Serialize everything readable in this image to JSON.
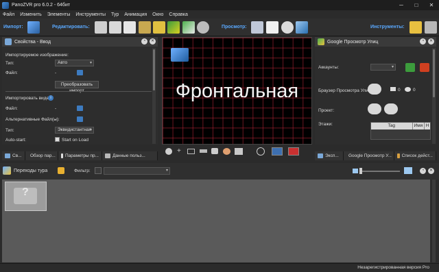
{
  "window": {
    "title": "PanoZVR pro 6.0.2 - 64бит",
    "minimize": "─",
    "maximize": "□",
    "close": "✕"
  },
  "menu": [
    "Файл",
    "Изменить",
    "Элементы",
    "Инструменты",
    "Тур",
    "Анимация",
    "Окно",
    "Справка"
  ],
  "toolbar": {
    "import_label": "Импорт:",
    "edit_label": "Редактировать:",
    "view_label": "Просмотр:",
    "tools_label": "Инструменты:"
  },
  "properties": {
    "title": "Свойства - Ввод",
    "imported_image_label": "Импортируемое изображение:",
    "type_label": "Тип:",
    "type_value": "Авто",
    "file_label": "Файл:",
    "file_value": "-",
    "transform_button": "Преобразовать импорт",
    "imported_video_label": "Импортировать видео:",
    "video_file_label": "Файл:",
    "video_file_value": "-",
    "alt_files_label": "Альтернативные Файл(ы):",
    "alt_files_value": "-",
    "video_type_label": "Тип:",
    "video_type_value": "Эквидистантная",
    "autostart_label": "Auto-start:",
    "start_on_load_label": "Start on Load"
  },
  "left_tabs": [
    "Св...",
    "Обзор пар...",
    "Параметры пр...",
    "Данные польз..."
  ],
  "viewer": {
    "face_label": "Фронтальная"
  },
  "streetview": {
    "title": "Google Просмотр Улиц",
    "accounts_label": "Аккаунты:",
    "browser_label": "Браузер Просмотра Улиц:",
    "count_views": "0",
    "count_eye": "0",
    "project_label": "Проект:",
    "floors_label": "Этажи:",
    "col_tag": "Tag",
    "col_name": "Имя",
    "col_h": "H"
  },
  "right_tabs": [
    "Эксп...",
    "Google Просмотр У...",
    "Список дейст..."
  ],
  "tour": {
    "title": "Переходы тура",
    "filter_label": "Фильтр:",
    "filter_value": ""
  },
  "status": {
    "text": "Незарегистрированная версия Pro"
  }
}
